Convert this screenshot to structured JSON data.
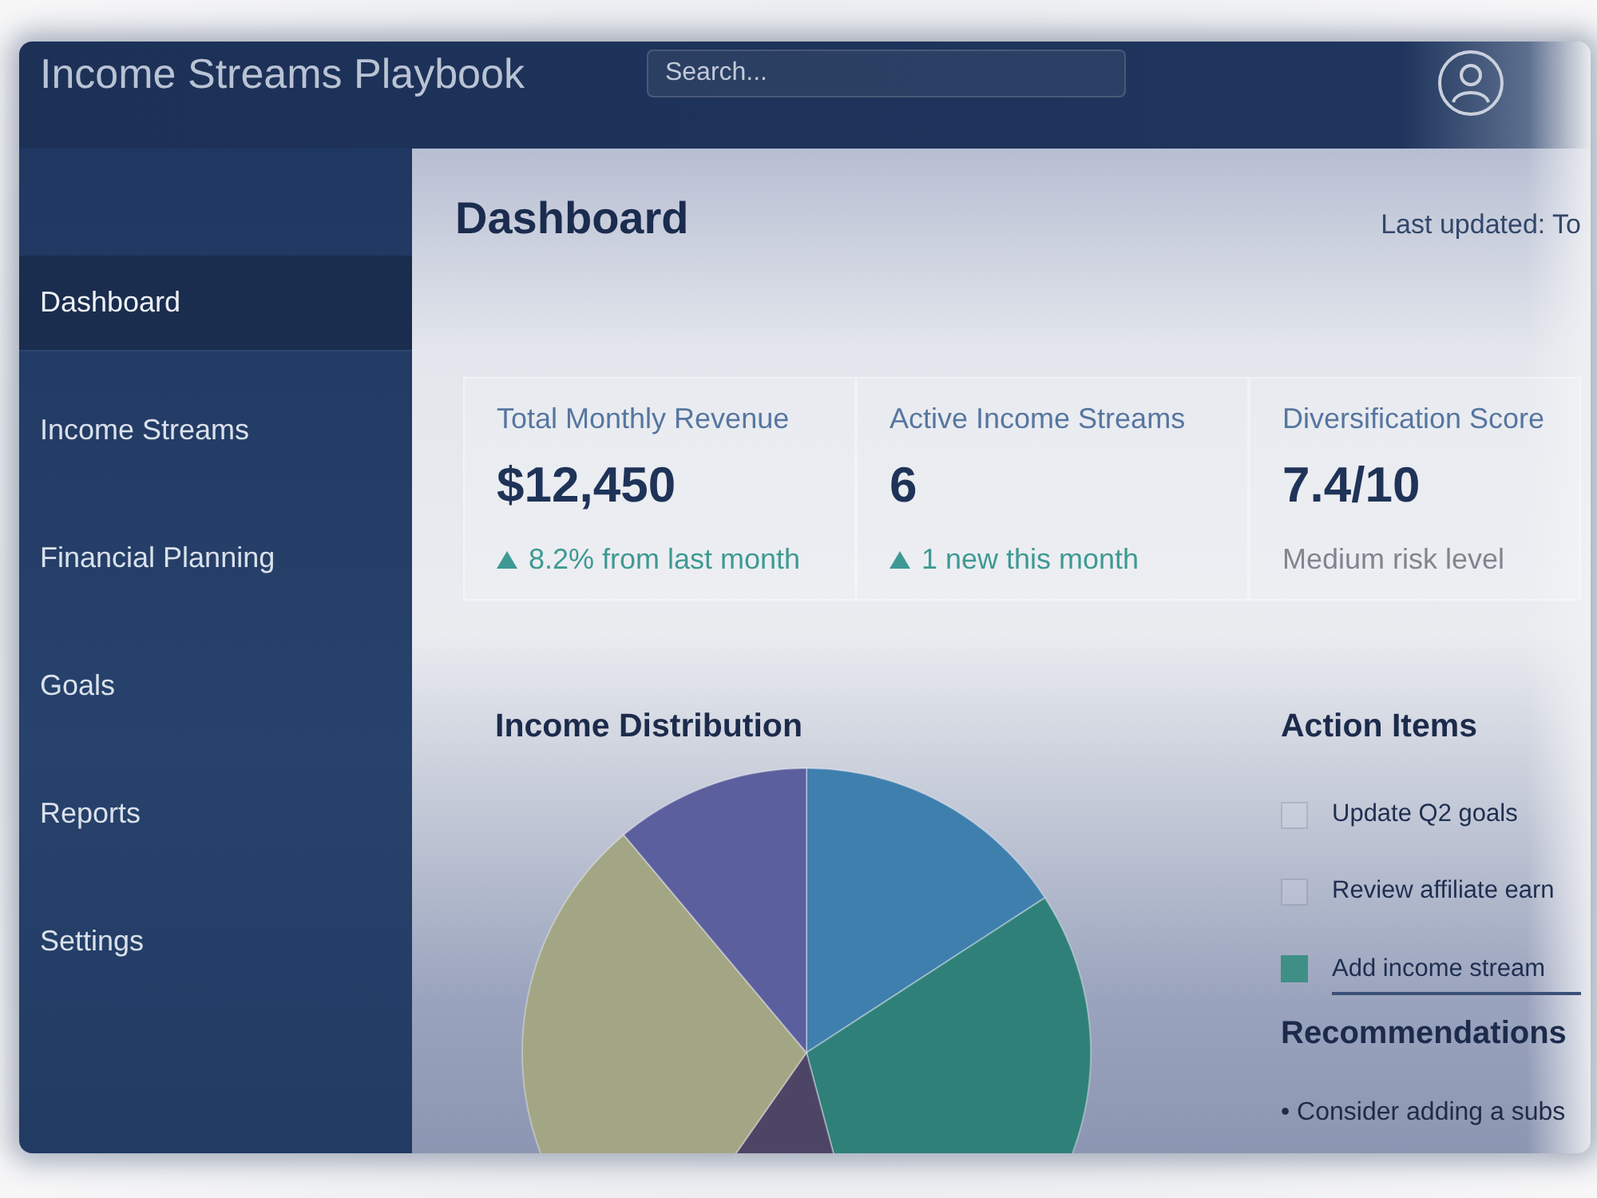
{
  "header": {
    "title": "Income Streams Playbook",
    "search": {
      "placeholder": "Search..."
    }
  },
  "sidebar": {
    "items": [
      {
        "label": "Dashboard",
        "selected": true
      },
      {
        "label": "Income Streams",
        "selected": false
      },
      {
        "label": "Financial Planning",
        "selected": false
      },
      {
        "label": "Goals",
        "selected": false
      },
      {
        "label": "Reports",
        "selected": false
      },
      {
        "label": "Settings",
        "selected": false
      }
    ]
  },
  "main": {
    "title": "Dashboard",
    "last_updated": "Last updated: To",
    "stats": [
      {
        "kind": "rising",
        "label": "Total Monthly Revenue",
        "value": "$12,450",
        "change": "8.2% from last month"
      },
      {
        "kind": "rising",
        "label": "Active Income Streams",
        "value": "6",
        "change": "1 new this month"
      },
      {
        "kind": "neutral",
        "label": "Diversification Score",
        "value": "7.4/10",
        "change": "Medium risk level"
      }
    ],
    "income_distribution": {
      "title": "Income Distribution"
    },
    "action_items": {
      "title": "Action Items",
      "items": [
        {
          "label": "Update Q2 goals",
          "checked": false
        },
        {
          "label": "Review affiliate earn",
          "checked": false
        },
        {
          "label": "Add income stream",
          "checked": true
        }
      ]
    },
    "recommendations": {
      "title": "Recommendations",
      "items": [
        "• Consider adding a subs"
      ]
    }
  }
}
